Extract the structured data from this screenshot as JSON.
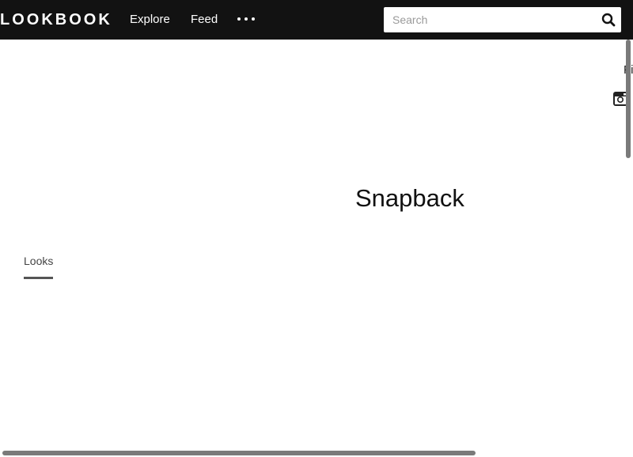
{
  "header": {
    "logo": "LOOKBOOK",
    "nav": [
      {
        "label": "Explore"
      },
      {
        "label": "Feed"
      }
    ],
    "more_icon": "more-horizontal-icon",
    "search": {
      "placeholder": "Search",
      "value": "",
      "icon": "search-icon"
    }
  },
  "side": {
    "follow_text": "Fi",
    "instagram_icon": "instagram-icon"
  },
  "main": {
    "title": "Snapback",
    "tabs": [
      {
        "label": "Looks",
        "active": true
      }
    ]
  },
  "colors": {
    "topbar_bg": "#121212",
    "topbar_text": "#ffffff",
    "page_bg": "#ffffff",
    "tab_underline": "#555555",
    "scrollbar": "#7a7a7a"
  }
}
